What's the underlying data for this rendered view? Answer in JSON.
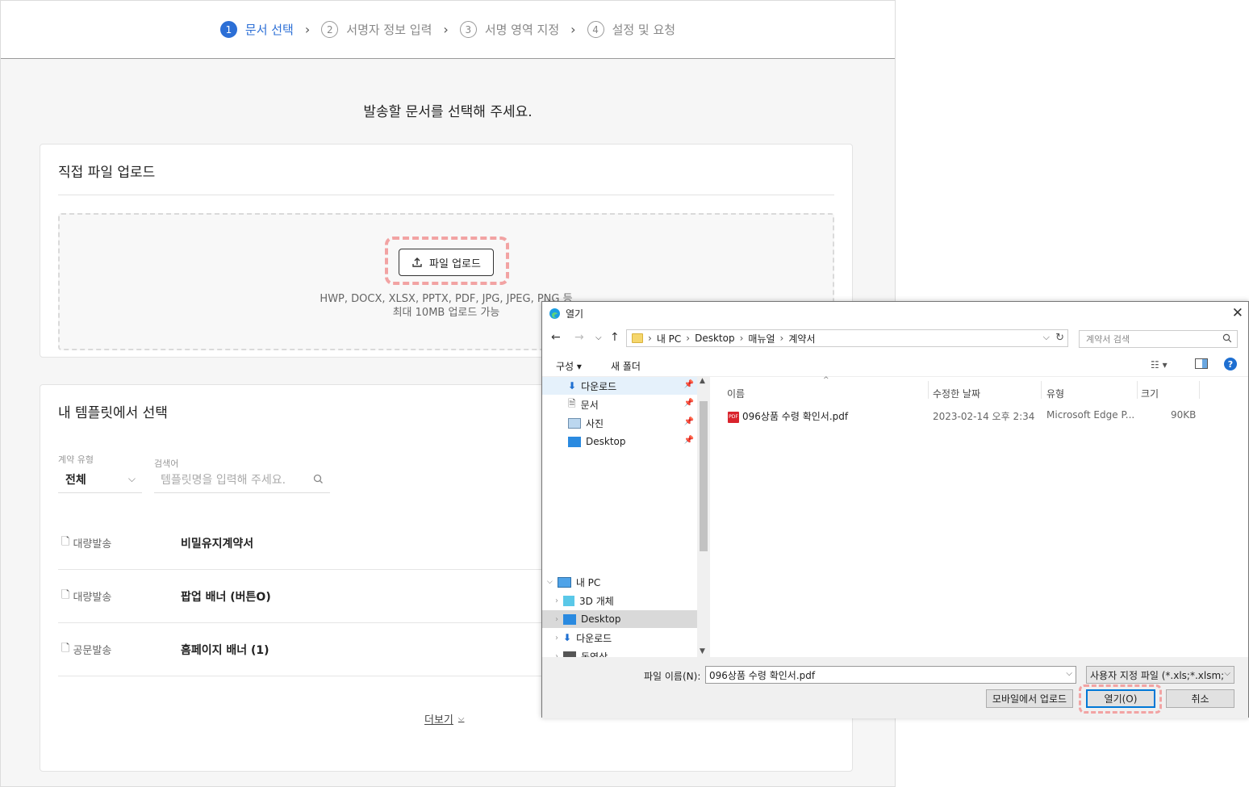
{
  "stepper": [
    {
      "num": "1",
      "label": "문서 선택"
    },
    {
      "num": "2",
      "label": "서명자 정보 입력"
    },
    {
      "num": "3",
      "label": "서명 영역 지정"
    },
    {
      "num": "4",
      "label": "설정 및 요청"
    }
  ],
  "main_title": "발송할 문서를 선택해 주세요.",
  "upload_card": {
    "title": "직접 파일 업로드",
    "button": "파일 업로드",
    "hint_formats": "HWP, DOCX, XLSX, PPTX, PDF, JPG, JPEG, PNG 등",
    "hint_size": "최대 10MB 업로드 가능"
  },
  "template_card": {
    "title": "내 템플릿에서 선택",
    "type_label": "계약 유형",
    "type_value": "전체",
    "search_label": "검색어",
    "search_placeholder": "템플릿명을 입력해 주세요.",
    "rows": [
      {
        "type": "대량발송",
        "name": "비밀유지계약서"
      },
      {
        "type": "대량발송",
        "name": "팝업 배너 (버튼O)"
      },
      {
        "type": "공문발송",
        "name": "홈페이지 배너 (1)"
      }
    ],
    "more": "더보기"
  },
  "dialog": {
    "title": "열기",
    "breadcrumb": [
      "내 PC",
      "Desktop",
      "매뉴얼",
      "계약서"
    ],
    "search_placeholder": "계약서 검색",
    "organize": "구성 ▾",
    "new_folder": "새 폴더",
    "quick_access": [
      {
        "label": "다운로드",
        "icon": "download-arrow-icon"
      },
      {
        "label": "문서",
        "icon": "document-icon"
      },
      {
        "label": "사진",
        "icon": "picture-icon"
      },
      {
        "label": "Desktop",
        "icon": "desktop-icon"
      }
    ],
    "this_pc": "내 PC",
    "pc_items": [
      "3D 개체",
      "Desktop",
      "다운로드",
      "동영상"
    ],
    "columns": {
      "name": "이름",
      "modified": "수정한 날짜",
      "type": "유형",
      "size": "크기"
    },
    "file": {
      "name": "096상품 수령 확인서.pdf",
      "modified": "2023-02-14 오후 2:34",
      "type": "Microsoft Edge P...",
      "size": "90KB"
    },
    "filename_label": "파일 이름(N):",
    "filename_value": "096상품 수령 확인서.pdf",
    "filetype_value": "사용자 지정 파일 (*.xls;*.xlsm;*",
    "mobile_upload": "모바일에서 업로드",
    "open": "열기(O)",
    "cancel": "취소"
  },
  "colors": {
    "accent": "#2c6fd6",
    "highlight": "#f2a3a3",
    "win_accent": "#0078d7"
  }
}
